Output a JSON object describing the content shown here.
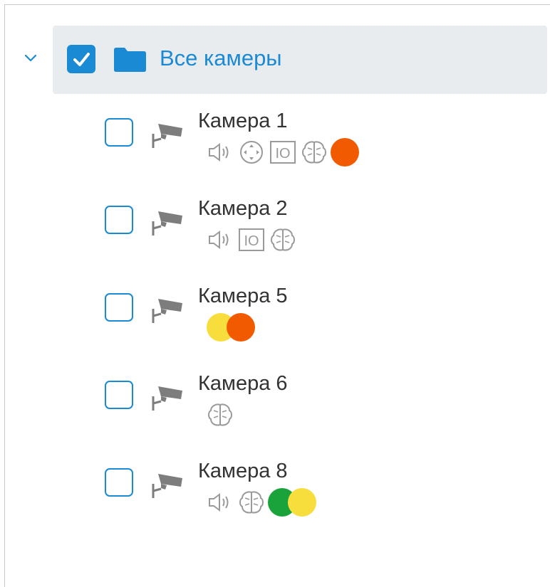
{
  "tree": {
    "root": {
      "label": "Все камеры",
      "checked": true,
      "expanded": true
    },
    "cameras": [
      {
        "name": "Камера 1",
        "checked": false,
        "icons": [
          "sound-icon",
          "ptz-icon",
          "io-icon",
          "brain-icon"
        ],
        "status_dots": [
          "#f25a00"
        ]
      },
      {
        "name": "Камера 2",
        "checked": false,
        "icons": [
          "sound-icon",
          "io-icon",
          "brain-icon"
        ],
        "status_dots": []
      },
      {
        "name": "Камера 5",
        "checked": false,
        "icons": [],
        "status_dots": [
          "#f7de3c",
          "#f25a00"
        ]
      },
      {
        "name": "Камера 6",
        "checked": false,
        "icons": [
          "brain-icon"
        ],
        "status_dots": []
      },
      {
        "name": "Камера 8",
        "checked": false,
        "icons": [
          "sound-icon",
          "brain-icon"
        ],
        "status_dots": [
          "#1aa33a",
          "#f7de3c"
        ]
      }
    ]
  },
  "io_label": "IO",
  "colors": {
    "accent": "#1a8ad4",
    "icon_gray": "#9a9a9a",
    "camera_gray": "#7d7d7d"
  }
}
